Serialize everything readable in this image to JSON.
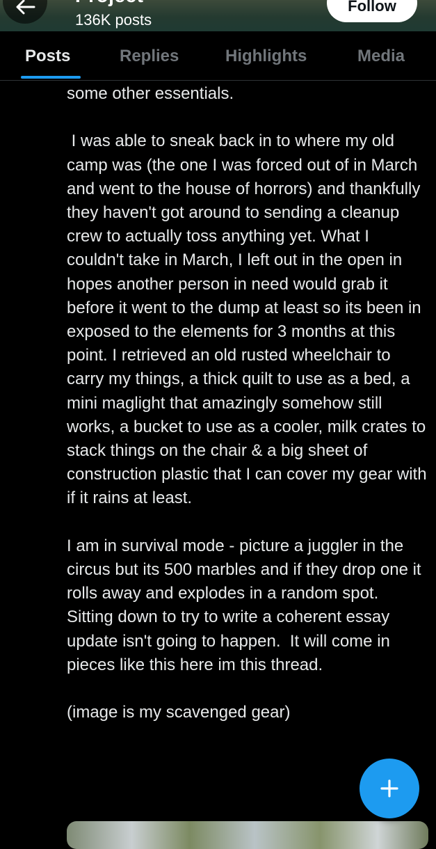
{
  "profile": {
    "name": "Project",
    "posts_count": "136K posts",
    "follow_label": "Follow"
  },
  "icons": {
    "back": "arrow-left-icon",
    "compose": "plus-icon"
  },
  "tabs": [
    {
      "label": "Posts",
      "active": true
    },
    {
      "label": "Replies",
      "active": false
    },
    {
      "label": "Highlights",
      "active": false
    },
    {
      "label": "Media",
      "active": false
    }
  ],
  "post": {
    "paragraphs": [
      "some other essentials.",
      " I was able to sneak back in to where my old camp was (the one I was forced out of in March and went to the house of horrors) and thankfully they haven't got around to sending a cleanup crew to actually toss anything yet. What I couldn't take in March, I left out in the open in hopes another person in need would grab it before it went to the dump at least so its been in exposed to the elements for 3 months at this point. I retrieved an old rusted wheelchair to carry my things, a thick quilt to use as a bed, a mini maglight that amazingly somehow still works, a bucket to use as a cooler, milk crates to stack things on the chair & a big sheet of construction plastic that I can cover my gear with if it rains at least.",
      "I am in survival mode - picture a juggler in the circus but its 500 marbles and if they drop one it rolls away and explodes in a random spot.  Sitting down to try to write a coherent essay update isn't going to happen.  It will come in pieces like this here im this thread.",
      "(image is my scavenged gear)"
    ]
  },
  "colors": {
    "accent": "#1d9bf0",
    "background": "#000000",
    "text": "#e7e9ea",
    "muted": "#71767b"
  }
}
